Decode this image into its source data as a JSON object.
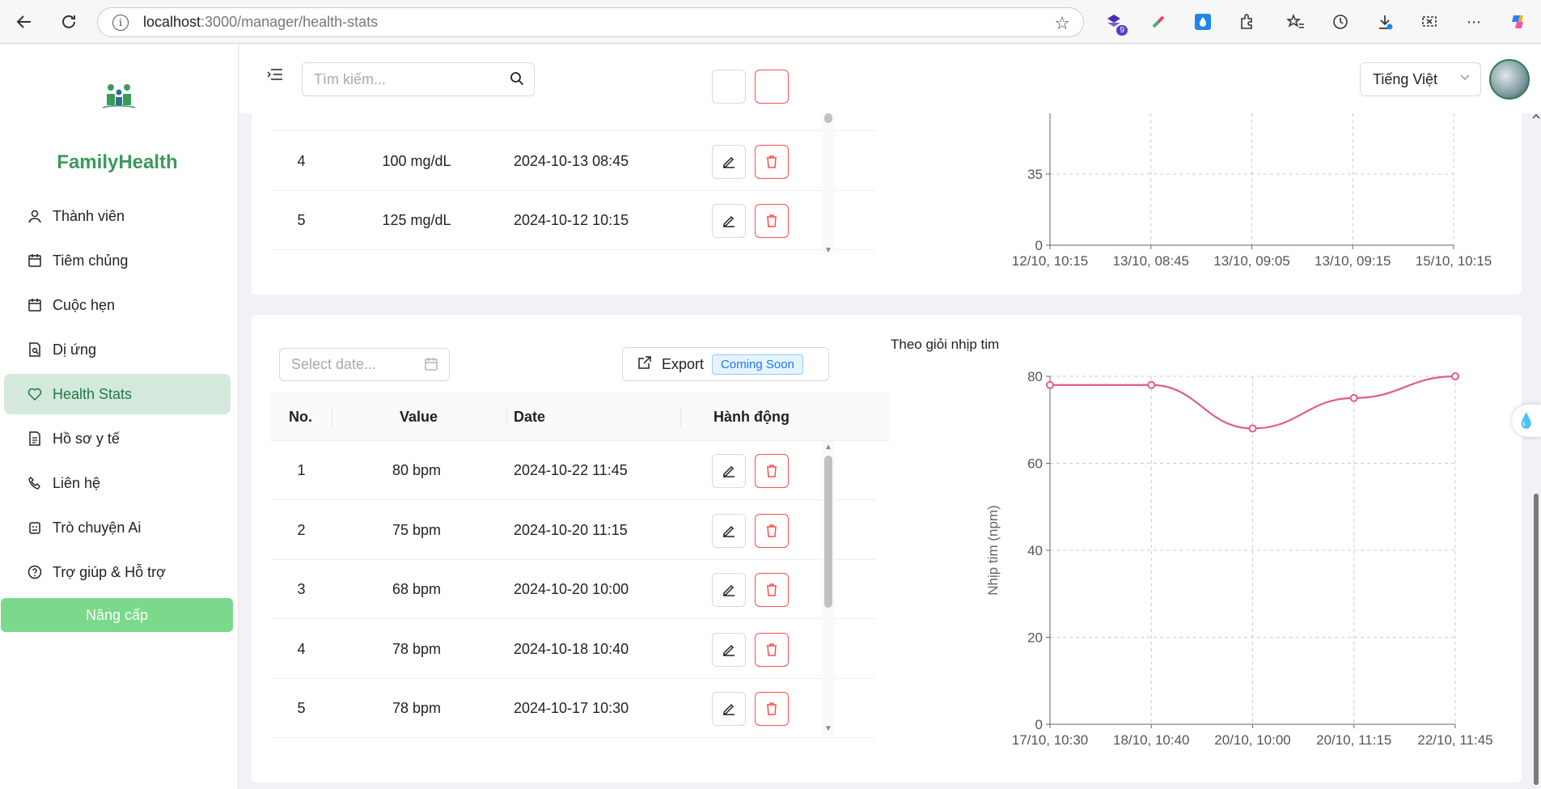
{
  "browser": {
    "url_host": "localhost",
    "url_path": ":3000/manager/health-stats",
    "extension_badge": "9"
  },
  "sidebar": {
    "brand": "FamilyHealth",
    "items": [
      {
        "label": "Thành viên",
        "icon": "user-icon"
      },
      {
        "label": "Tiêm chủng",
        "icon": "calendar-icon"
      },
      {
        "label": "Cuộc hẹn",
        "icon": "calendar-icon"
      },
      {
        "label": "Dị ứng",
        "icon": "document-search-icon"
      },
      {
        "label": "Health Stats",
        "icon": "heart-icon",
        "active": true
      },
      {
        "label": "Hồ sơ y tế",
        "icon": "file-icon"
      },
      {
        "label": "Liên hệ",
        "icon": "phone-icon"
      },
      {
        "label": "Trò chuyện Ai",
        "icon": "robot-icon"
      },
      {
        "label": "Trợ giúp & Hỗ trợ",
        "icon": "help-icon"
      }
    ],
    "upgrade_label": "Nâng cấp"
  },
  "header": {
    "search_placeholder": "Tìm kiếm...",
    "language": "Tiếng Việt"
  },
  "glucose_section": {
    "rows": [
      {
        "no": "4",
        "value": "100 mg/dL",
        "date": "2024-10-13 08:45"
      },
      {
        "no": "5",
        "value": "125 mg/dL",
        "date": "2024-10-12 10:15"
      }
    ],
    "chart_data": {
      "type": "line",
      "x": [
        "12/10, 10:15",
        "13/10, 08:45",
        "13/10, 09:05",
        "13/10, 09:15",
        "15/10, 10:15"
      ],
      "y_ticks_visible": [
        "35",
        "0"
      ],
      "y_tick_values": [
        35,
        0
      ],
      "ylim": [
        0,
        35
      ],
      "grid": true
    }
  },
  "heart_section": {
    "date_placeholder": "Select date...",
    "export_label": "Export",
    "coming_soon": "Coming Soon",
    "columns": [
      "No.",
      "Value",
      "Date",
      "Hành động"
    ],
    "rows": [
      {
        "no": "1",
        "value": "80 bpm",
        "date": "2024-10-22 11:45"
      },
      {
        "no": "2",
        "value": "75 bpm",
        "date": "2024-10-20 11:15"
      },
      {
        "no": "3",
        "value": "68 bpm",
        "date": "2024-10-20 10:00"
      },
      {
        "no": "4",
        "value": "78 bpm",
        "date": "2024-10-18 10:40"
      },
      {
        "no": "5",
        "value": "78 bpm",
        "date": "2024-10-17 10:30"
      }
    ],
    "chart_data": {
      "type": "line",
      "title": "Theo giỏi nhịp tim",
      "ylabel": "Nhịp tim (npm)",
      "xlabel": "",
      "categories": [
        "17/10, 10:30",
        "18/10, 10:40",
        "20/10, 10:00",
        "20/10, 11:15",
        "22/10, 11:45"
      ],
      "values": [
        78,
        78,
        68,
        75,
        80
      ],
      "yticks": [
        0,
        20,
        40,
        60,
        80
      ],
      "ylim": [
        0,
        80
      ],
      "grid": true,
      "color": "#e05a8f"
    }
  },
  "colors": {
    "brand": "#3a9a5c",
    "active_bg": "#d4e8dc",
    "upgrade": "#7ad98a",
    "danger": "#ff4d4f",
    "line": "#e05a8f"
  }
}
